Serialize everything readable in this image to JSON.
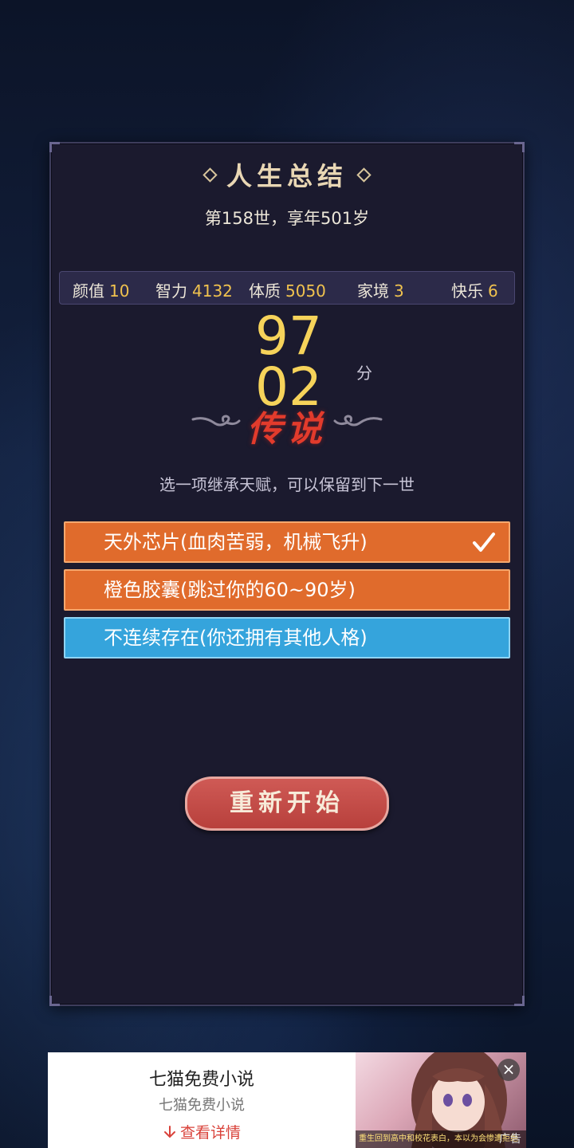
{
  "summary": {
    "title": "人生总结",
    "life_info": "第158世，享年501岁"
  },
  "stats": [
    {
      "label": "颜值",
      "value": "10"
    },
    {
      "label": "智力",
      "value": "4132"
    },
    {
      "label": "体质",
      "value": "5050"
    },
    {
      "label": "家境",
      "value": "3"
    },
    {
      "label": "快乐",
      "value": "6"
    }
  ],
  "score": {
    "value": "9702",
    "unit": "分",
    "rank": "传说"
  },
  "talent": {
    "hint": "选一项继承天赋，可以保留到下一世",
    "options": [
      {
        "label": "天外芯片(血肉苦弱，机械飞升)",
        "color": "#e06b2c",
        "selected": true
      },
      {
        "label": "橙色胶囊(跳过你的60~90岁)",
        "color": "#e06b2c",
        "selected": false
      },
      {
        "label": "不连续存在(你还拥有其他人格)",
        "color": "#35a4dc",
        "selected": false
      }
    ]
  },
  "restart_label": "重新开始",
  "ad": {
    "title": "七猫免费小说",
    "subtitle": "七猫免费小说",
    "cta": "查看详情",
    "image_caption": "重生回到高中和校花表白，本以为会惨遭拒绝",
    "label": "广告",
    "close": "×"
  },
  "colors": {
    "accent_gold": "#f0c24e",
    "rank_red": "#e23b2c",
    "option_orange": "#e06b2c",
    "option_blue": "#35a4dc",
    "restart_red": "#c44c48"
  }
}
